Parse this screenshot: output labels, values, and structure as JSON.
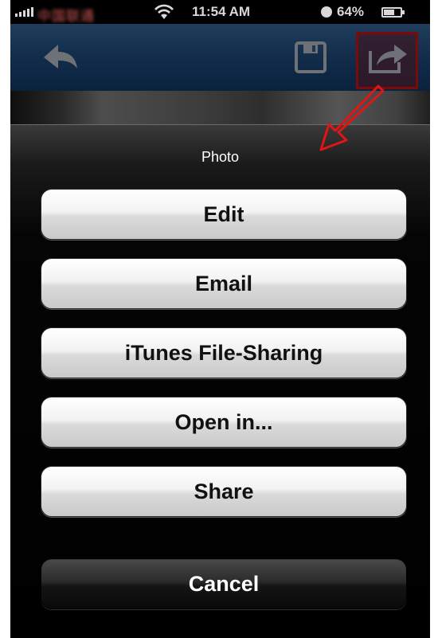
{
  "status_bar": {
    "carrier": "中国联通",
    "time": "11:54 AM",
    "battery": "64%"
  },
  "nav_bar": {
    "icons": [
      "back-arrow-icon",
      "save-icon",
      "share-icon"
    ]
  },
  "action_sheet": {
    "title": "Photo",
    "buttons": [
      {
        "label": "Edit"
      },
      {
        "label": "Email"
      },
      {
        "label": "iTunes File-Sharing"
      },
      {
        "label": "Open in..."
      },
      {
        "label": "Share"
      }
    ],
    "cancel": {
      "label": "Cancel"
    }
  },
  "colors": {
    "annotation_red": "#e01515",
    "nav_blue": "#2b5d96"
  }
}
